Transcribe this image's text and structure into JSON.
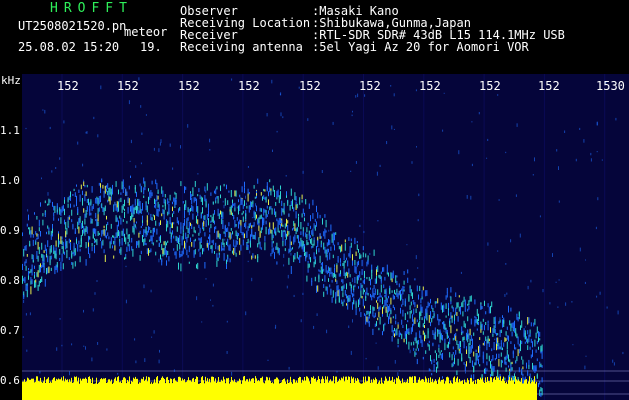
{
  "header": {
    "brand": "HROFFT",
    "filename": "UT2508021520.pn",
    "type": "meteor",
    "datetime": "25.08.02 15:20",
    "index": "19.",
    "fields": [
      {
        "label": "Observer",
        "value": ":Masaki Kano"
      },
      {
        "label": "Receiving Location",
        "value": ":Shibukawa,Gunma,Japan"
      },
      {
        "label": "Receiver",
        "value": ":RTL-SDR SDR# 43dB L15 114.1MHz USB"
      },
      {
        "label": "Receiving antenna",
        "value": ":5el Yagi Az 20 for Aomori VOR"
      }
    ]
  },
  "axes": {
    "y_unit": "kHz",
    "y_ticks": [
      "1.1",
      "1.0",
      "0.9",
      "0.8",
      "0.7",
      "0.6"
    ],
    "x_ticks": [
      "152",
      "152",
      "152",
      "152",
      "152",
      "152",
      "152",
      "152",
      "152",
      "1530"
    ]
  },
  "colors": {
    "background": "#05053a",
    "signal_low": "#1e6cff",
    "signal_mid": "#2fd6d0",
    "signal_high": "#e8f04a",
    "noise_band": "#ffff00"
  }
}
